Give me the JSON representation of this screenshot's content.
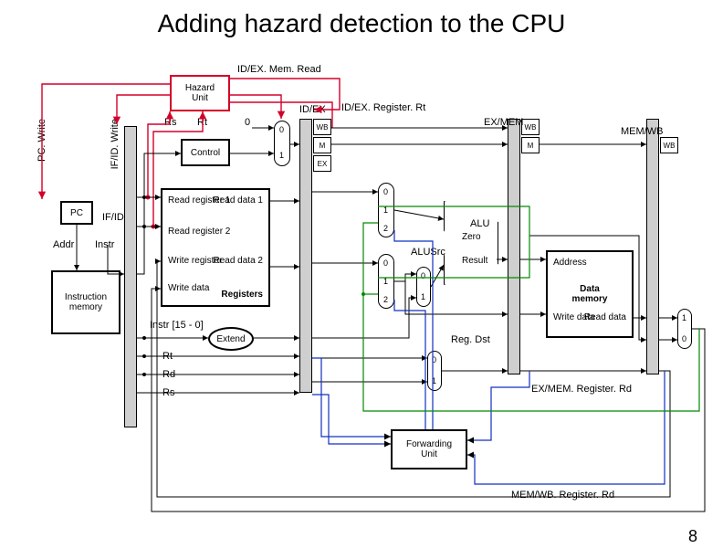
{
  "title": "Adding hazard detection to the CPU",
  "slide_number": "8",
  "signals": {
    "idex_memread": "ID/EX. Mem. Read",
    "idex_reg_rt": "ID/EX. Register. Rt",
    "exmem_reg_rd": "EX/MEM. Register. Rd",
    "memwb_reg_rd": "MEM/WB. Register. Rd",
    "alusrc": "ALUSrc",
    "regdst": "Reg. Dst"
  },
  "blocks": {
    "hazard": "Hazard\nUnit",
    "pc": "PC",
    "instr_mem": "Instruction\nmemory",
    "control": "Control",
    "regfile_rr1": "Read\nregister 1",
    "regfile_rd1": "Read\ndata 1",
    "regfile_rr2": "Read\nregister 2",
    "regfile_wr": "Write\nregister",
    "regfile_rd2": "Read\ndata 2",
    "regfile_wd": "Write\ndata",
    "regfile_title": "Registers",
    "extend": "Extend",
    "alu": "ALU",
    "alu_zero": "Zero",
    "alu_result": "Result",
    "dmem": "Data\nmemory",
    "dmem_addr": "Address",
    "dmem_wd": "Write\ndata",
    "dmem_rd": "Read\ndata",
    "fwd": "Forwarding\nUnit"
  },
  "field_labels": {
    "rs": "Rs",
    "rt": "Rt",
    "rd": "Rd",
    "instr_range": "Instr [15 - 0]"
  },
  "io_labels": {
    "addr": "Addr",
    "instr": "Instr"
  },
  "pipe": {
    "ifid": "IF/ID",
    "idex": "ID/EX",
    "exmem": "EX/MEM",
    "memwb": "MEM/WB"
  },
  "pipe_ctrl": {
    "wb": "WB",
    "m": "M",
    "ex": "EX"
  },
  "stall_labels": {
    "pcwrite": "PC. Write",
    "ifidwrite": "IF/ID. Write"
  },
  "mux_labels": {
    "zero": "0",
    "one": "1",
    "two": "2"
  }
}
